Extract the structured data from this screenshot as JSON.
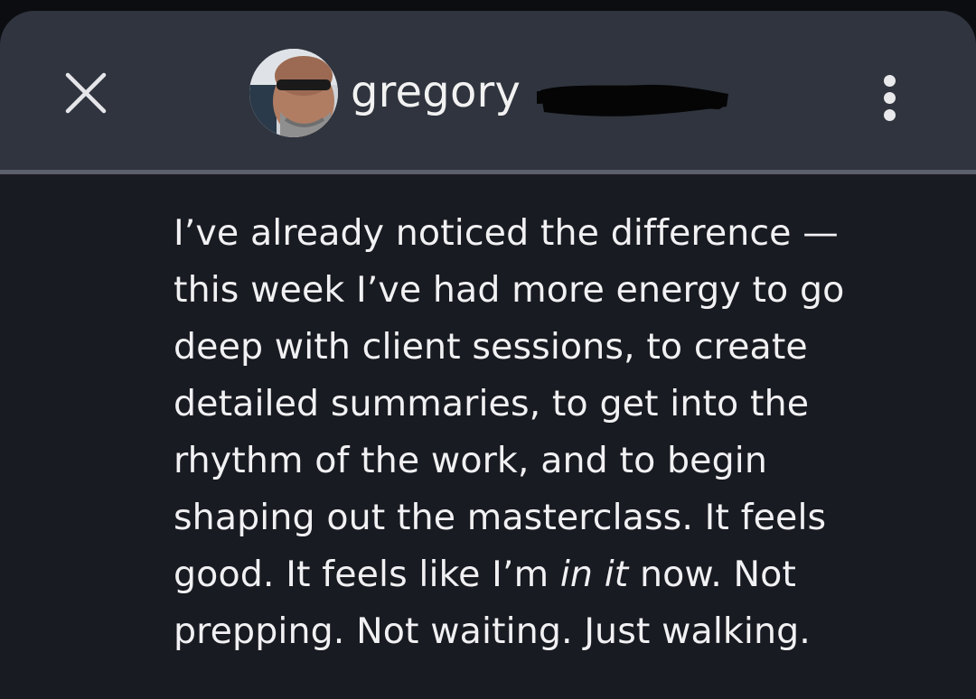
{
  "header": {
    "close_icon": "close-icon",
    "username": "gregory",
    "more_icon": "more-vertical-icon"
  },
  "message": {
    "lines": [
      "I’ve already noticed the difference —",
      "this week I’ve had more energy to go",
      "deep with client sessions, to create",
      "detailed summaries, to get into the",
      "rhythm of the work, and to begin",
      "shaping out the masterclass. It feels"
    ],
    "line7": {
      "before": "good. It feels like I’m ",
      "emphasis": "in it",
      "after": " now. Not"
    },
    "line8": "prepping. Not waiting. Just walking."
  },
  "colors": {
    "header_bg": "#2f343e",
    "body_bg": "#191b22",
    "text": "#f1f1f3"
  }
}
